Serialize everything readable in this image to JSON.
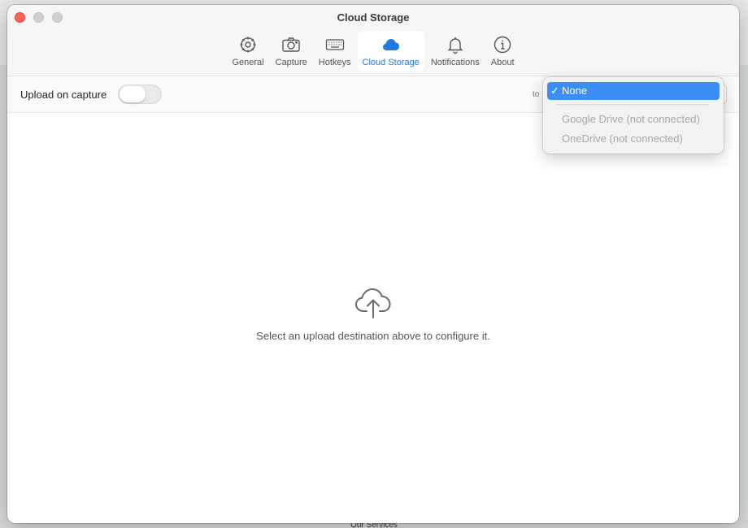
{
  "window": {
    "title": "Cloud Storage"
  },
  "toolbar": {
    "items": [
      {
        "label": "General",
        "icon": "gear-icon",
        "active": false
      },
      {
        "label": "Capture",
        "icon": "camera-icon",
        "active": false
      },
      {
        "label": "Hotkeys",
        "icon": "keyboard-icon",
        "active": false
      },
      {
        "label": "Cloud Storage",
        "icon": "cloud-icon",
        "active": true
      },
      {
        "label": "Notifications",
        "icon": "bell-icon",
        "active": false
      },
      {
        "label": "About",
        "icon": "info-icon",
        "active": false
      }
    ]
  },
  "upload": {
    "label": "Upload on capture",
    "enabled": false,
    "to_label": "to"
  },
  "destination_menu": {
    "selected": "None",
    "check": "✓",
    "options": [
      {
        "label": "Google Drive (not connected)",
        "disabled": true
      },
      {
        "label": "OneDrive (not connected)",
        "disabled": true
      }
    ]
  },
  "empty_state": {
    "icon": "cloud-upload-icon",
    "message": "Select an upload destination above to configure it."
  },
  "background": {
    "footer_text": "Our Services"
  },
  "colors": {
    "accent": "#1f7ae0",
    "selection": "#3a8ef5",
    "close": "#fe5f57"
  }
}
